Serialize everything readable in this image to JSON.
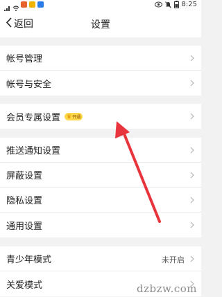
{
  "status_bar": {
    "time": "8:25",
    "left_icons": [
      "signal-icon",
      "wifi-icon",
      "app-notification-icon",
      "app-notification-icon",
      "app-notification-icon"
    ],
    "right_icons": [
      "eye-icon",
      "mute-icon",
      "battery-icon"
    ]
  },
  "header": {
    "back_label": "返回",
    "title": "设置"
  },
  "sections": {
    "account": {
      "items": [
        {
          "label": "帐号管理"
        },
        {
          "label": "帐号与安全"
        }
      ]
    },
    "member": {
      "label": "会员专属设置",
      "badge": "开通"
    },
    "prefs": {
      "items": [
        {
          "label": "推送通知设置"
        },
        {
          "label": "屏蔽设置"
        },
        {
          "label": "隐私设置"
        },
        {
          "label": "通用设置"
        }
      ]
    },
    "modes": {
      "items": [
        {
          "label": "青少年模式",
          "value": "未开启"
        },
        {
          "label": "关爱模式"
        }
      ]
    }
  },
  "watermark": "dzbzw.com",
  "colors": {
    "arrow": "#e8353d",
    "badge_bg": "#ffd84a",
    "background": "#f2f2f2"
  }
}
